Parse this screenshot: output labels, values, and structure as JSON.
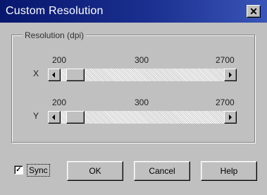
{
  "window": {
    "title": "Custom Resolution",
    "close_glyph": "✕"
  },
  "group": {
    "label": "Resolution (dpi)"
  },
  "x_slider": {
    "axis_label": "X",
    "min_label": "200",
    "mid_label": "300",
    "max_label": "2700",
    "value": 300
  },
  "y_slider": {
    "axis_label": "Y",
    "min_label": "200",
    "mid_label": "300",
    "max_label": "2700",
    "value": 300
  },
  "sync": {
    "label": "Sync",
    "checked": true,
    "check_glyph": "✓"
  },
  "buttons": {
    "ok": "OK",
    "cancel": "Cancel",
    "help": "Help"
  },
  "icons": {
    "close": "close-icon",
    "scroll_left": "arrow-left-icon",
    "scroll_right": "arrow-right-icon"
  }
}
